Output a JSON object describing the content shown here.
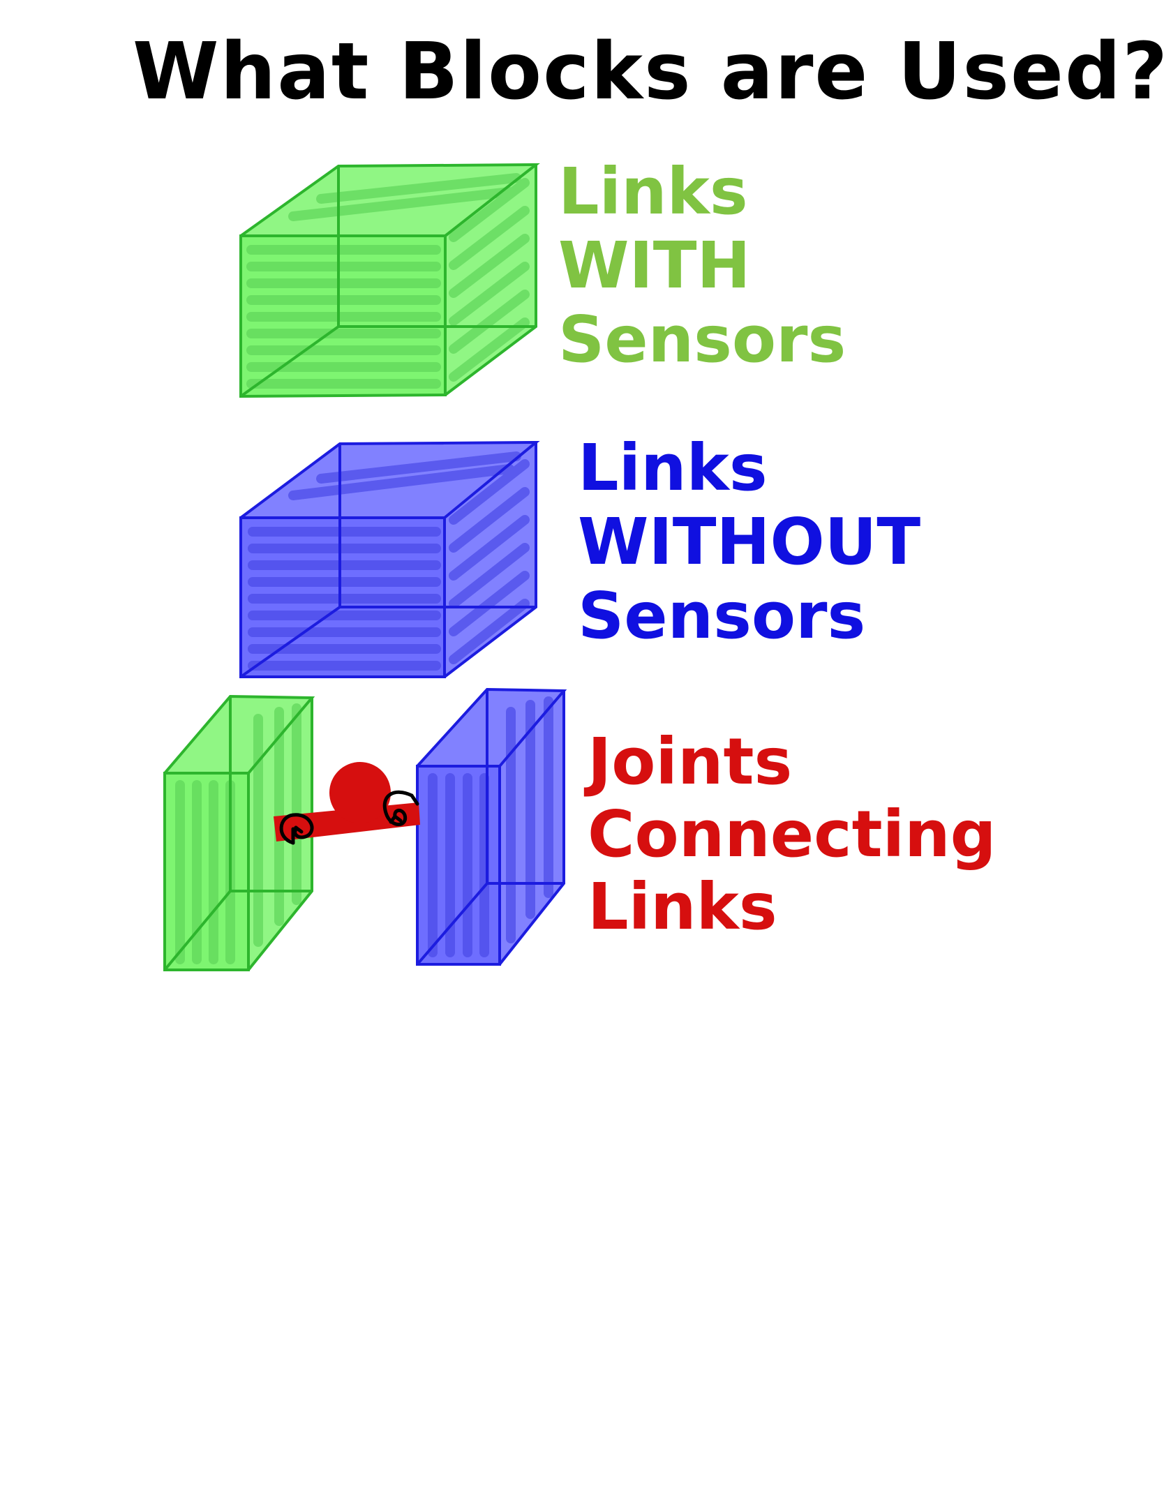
{
  "title": "What Blocks are Used?",
  "legend": [
    {
      "lines": [
        "Links",
        "WITH",
        "Sensors"
      ],
      "color": "#80c342"
    },
    {
      "lines": [
        "Links",
        "WITHOUT",
        "Sensors"
      ],
      "color": "#1010e0"
    },
    {
      "lines": [
        "Joints",
        "Connecting",
        "Links"
      ],
      "color": "#d60f0f"
    }
  ],
  "colors": {
    "green_fill": "#7cf56f",
    "green_edge": "#2db52d",
    "blue_fill": "#6b6bff",
    "blue_edge": "#1c1cdf",
    "red": "#d60f0f"
  }
}
